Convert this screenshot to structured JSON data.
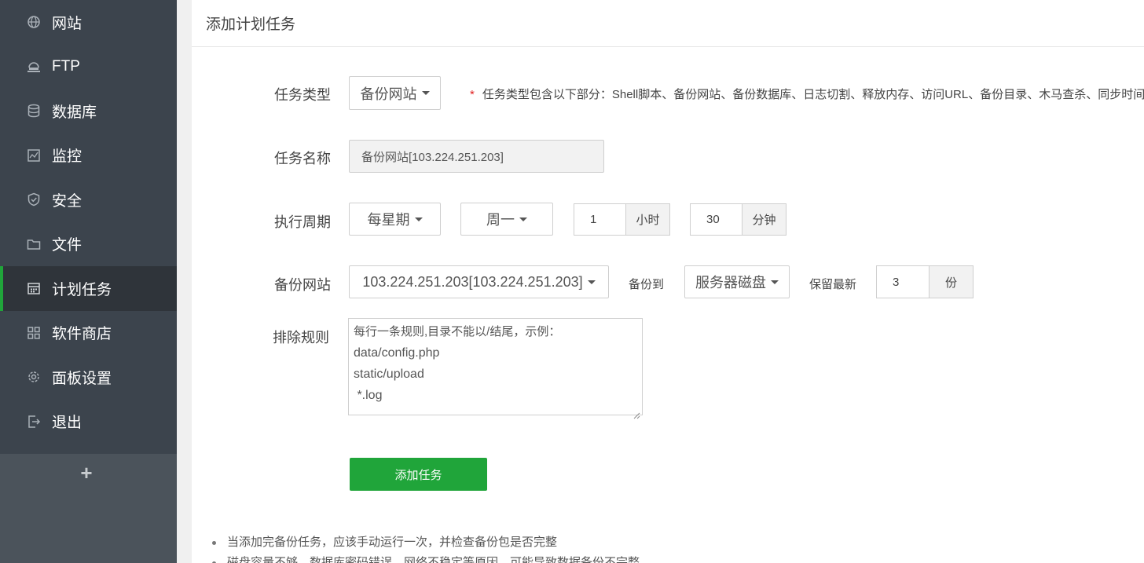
{
  "sidebar": {
    "items": [
      {
        "label": "网站",
        "icon": "globe-icon"
      },
      {
        "label": "FTP",
        "icon": "ftp-icon"
      },
      {
        "label": "数据库",
        "icon": "database-icon"
      },
      {
        "label": "监控",
        "icon": "monitor-icon"
      },
      {
        "label": "安全",
        "icon": "shield-icon"
      },
      {
        "label": "文件",
        "icon": "folder-icon"
      },
      {
        "label": "计划任务",
        "icon": "calendar-icon",
        "active": true
      },
      {
        "label": "软件商店",
        "icon": "apps-icon"
      },
      {
        "label": "面板设置",
        "icon": "gear-icon"
      },
      {
        "label": "退出",
        "icon": "logout-icon"
      }
    ],
    "add_symbol": "+"
  },
  "header": {
    "title": "添加计划任务"
  },
  "form": {
    "task_type": {
      "label": "任务类型",
      "value": "备份网站",
      "hint_star": "*",
      "hint": "任务类型包含以下部分：Shell脚本、备份网站、备份数据库、日志切割、释放内存、访问URL、备份目录、木马查杀、同步时间"
    },
    "task_name": {
      "label": "任务名称",
      "value": "备份网站[103.224.251.203]"
    },
    "cycle": {
      "label": "执行周期",
      "period": "每星期",
      "weekday": "周一",
      "hour": "1",
      "hour_unit": "小时",
      "minute": "30",
      "minute_unit": "分钟"
    },
    "backup_site": {
      "label": "备份网站",
      "value": "103.224.251.203[103.224.251.203]",
      "backup_to_label": "备份到",
      "backup_to": "服务器磁盘",
      "keep_label": "保留最新",
      "keep_value": "3",
      "keep_unit": "份"
    },
    "exclude": {
      "label": "排除规则",
      "placeholder": "每行一条规则,目录不能以/结尾，示例：",
      "lines": [
        "data/config.php",
        "static/upload",
        " *.log"
      ]
    },
    "submit_label": "添加任务"
  },
  "tips": [
    "当添加完备份任务，应该手动运行一次，并检查备份包是否完整",
    "磁盘容量不够、数据库密码错误、网络不稳定等原因，可能导致数据备份不完整"
  ],
  "colors": {
    "sidebar_bg": "#3c444d",
    "sidebar_active_bg": "#2f343a",
    "accent_green": "#20a53a",
    "required_star": "#e02020"
  }
}
